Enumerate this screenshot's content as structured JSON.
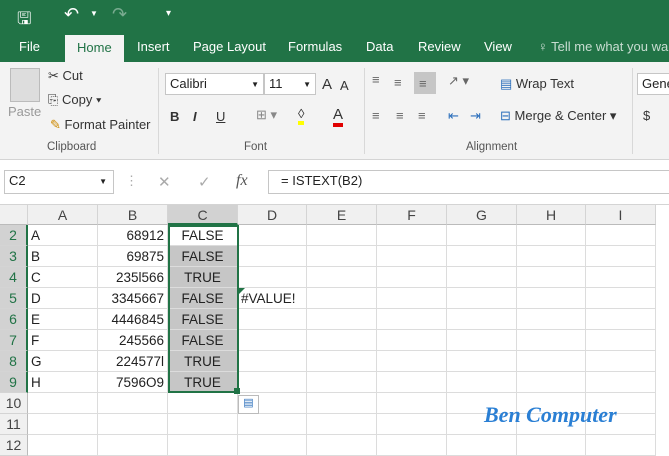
{
  "qat": {
    "save": "save-icon",
    "undo": "undo-icon",
    "redo": "redo-icon",
    "customize": "▾"
  },
  "tabs": [
    "File",
    "Home",
    "Insert",
    "Page Layout",
    "Formulas",
    "Data",
    "Review",
    "View"
  ],
  "tell_me": "Tell me what you wa",
  "clipboard": {
    "paste": "Paste",
    "cut": "Cut",
    "copy": "Copy",
    "format_painter": "Format Painter",
    "label": "Clipboard"
  },
  "font": {
    "name": "Calibri",
    "size": "11",
    "bold": "B",
    "italic": "I",
    "underline": "U",
    "grow": "A",
    "shrink": "A",
    "color": "A",
    "label": "Font",
    "fill_color": "#ffff00",
    "font_color": "#e00000"
  },
  "alignment": {
    "wrap": "Wrap Text",
    "merge": "Merge & Center",
    "label": "Alignment"
  },
  "number": {
    "format": "Gene",
    "currency": "$"
  },
  "formula_bar": {
    "name_box": "C2",
    "cancel": "✕",
    "enter": "✓",
    "fx": "fx",
    "formula": "= ISTEXT(B2)"
  },
  "columns": [
    "A",
    "B",
    "C",
    "D",
    "E",
    "F",
    "G",
    "H",
    "I"
  ],
  "rows": [
    {
      "n": "2",
      "a": "A",
      "b": "68912",
      "c": "FALSE",
      "d": ""
    },
    {
      "n": "3",
      "a": "B",
      "b": "69875",
      "c": "FALSE",
      "d": ""
    },
    {
      "n": "4",
      "a": "C",
      "b": "235l566",
      "c": "TRUE",
      "d": ""
    },
    {
      "n": "5",
      "a": "D",
      "b": "3345667",
      "c": "FALSE",
      "d": "#VALUE!"
    },
    {
      "n": "6",
      "a": "E",
      "b": "4446845",
      "c": "FALSE",
      "d": ""
    },
    {
      "n": "7",
      "a": "F",
      "b": "245566",
      "c": "FALSE",
      "d": ""
    },
    {
      "n": "8",
      "a": "G",
      "b": "224577l",
      "c": "TRUE",
      "d": ""
    },
    {
      "n": "9",
      "a": "H",
      "b": "7596O9",
      "c": "TRUE",
      "d": ""
    },
    {
      "n": "10",
      "a": "",
      "b": "",
      "c": "",
      "d": ""
    },
    {
      "n": "11",
      "a": "",
      "b": "",
      "c": "",
      "d": ""
    },
    {
      "n": "12",
      "a": "",
      "b": "",
      "c": "",
      "d": ""
    }
  ],
  "watermark": "Ben Computer",
  "colors": {
    "brand": "#217346",
    "selection": "#c6c6c6"
  }
}
